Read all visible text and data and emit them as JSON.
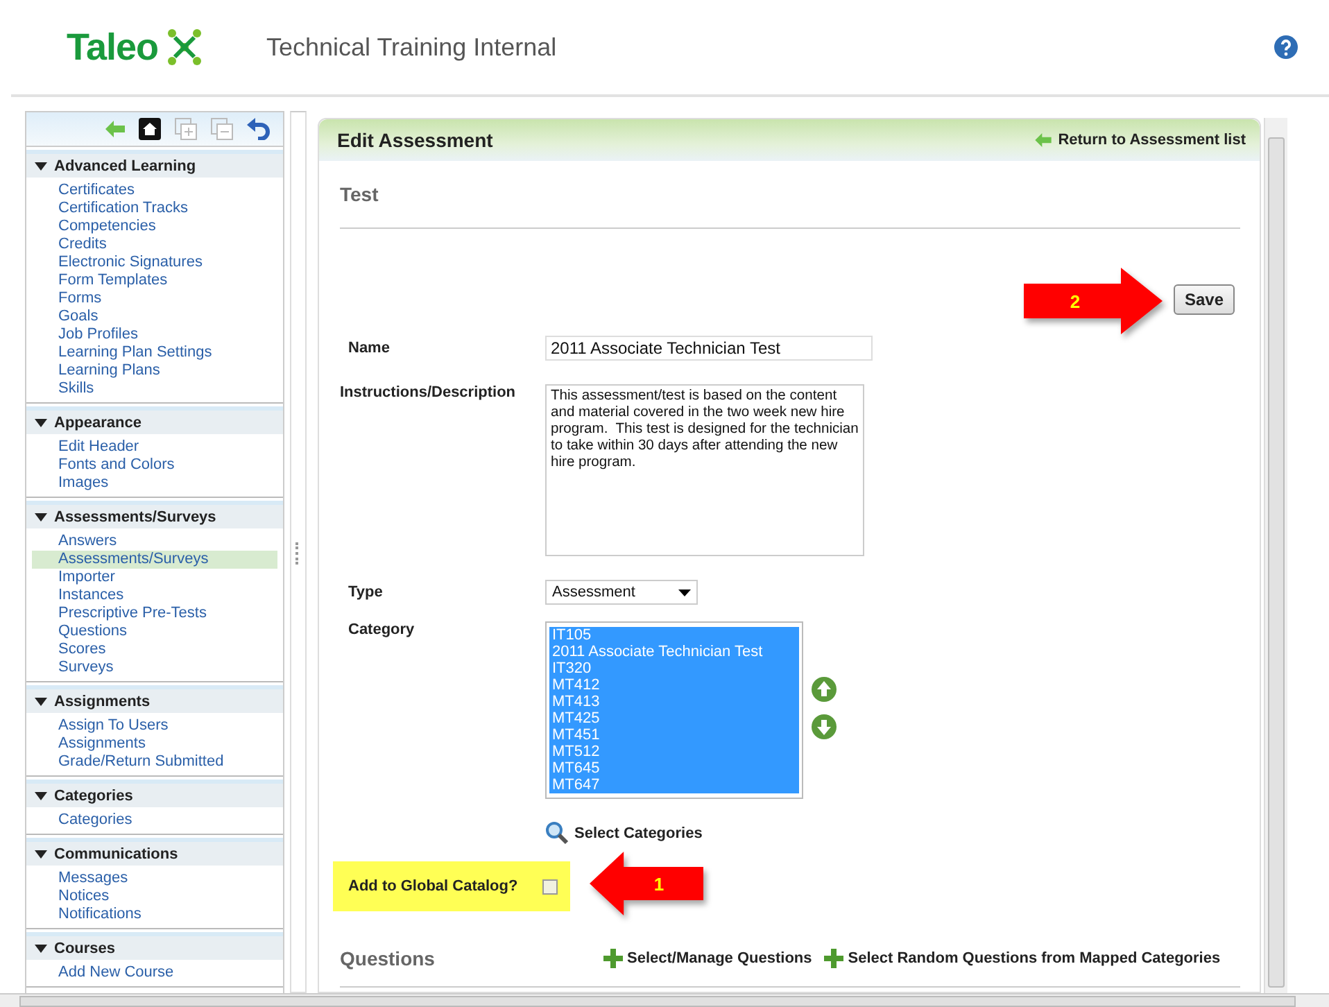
{
  "header": {
    "logo": "Taleo",
    "title": "Technical Training Internal"
  },
  "sidebar": {
    "sections": [
      {
        "title": "Advanced Learning",
        "expanded": true,
        "items": [
          {
            "label": "Certificates",
            "selected": false
          },
          {
            "label": "Certification Tracks",
            "selected": false
          },
          {
            "label": "Competencies",
            "selected": false
          },
          {
            "label": "Credits",
            "selected": false
          },
          {
            "label": "Electronic Signatures",
            "selected": false
          },
          {
            "label": "Form Templates",
            "selected": false
          },
          {
            "label": "Forms",
            "selected": false
          },
          {
            "label": "Goals",
            "selected": false
          },
          {
            "label": "Job Profiles",
            "selected": false
          },
          {
            "label": "Learning Plan Settings",
            "selected": false
          },
          {
            "label": "Learning Plans",
            "selected": false
          },
          {
            "label": "Skills",
            "selected": false
          }
        ]
      },
      {
        "title": "Appearance",
        "expanded": true,
        "items": [
          {
            "label": "Edit Header",
            "selected": false
          },
          {
            "label": "Fonts and Colors",
            "selected": false
          },
          {
            "label": "Images",
            "selected": false
          }
        ]
      },
      {
        "title": "Assessments/Surveys",
        "expanded": true,
        "items": [
          {
            "label": "Answers",
            "selected": false
          },
          {
            "label": "Assessments/Surveys",
            "selected": true
          },
          {
            "label": "Importer",
            "selected": false
          },
          {
            "label": "Instances",
            "selected": false
          },
          {
            "label": "Prescriptive Pre-Tests",
            "selected": false
          },
          {
            "label": "Questions",
            "selected": false
          },
          {
            "label": "Scores",
            "selected": false
          },
          {
            "label": "Surveys",
            "selected": false
          }
        ]
      },
      {
        "title": "Assignments",
        "expanded": true,
        "items": [
          {
            "label": "Assign To Users",
            "selected": false
          },
          {
            "label": "Assignments",
            "selected": false
          },
          {
            "label": "Grade/Return Submitted",
            "selected": false
          }
        ]
      },
      {
        "title": "Categories",
        "expanded": true,
        "items": [
          {
            "label": "Categories",
            "selected": false
          }
        ]
      },
      {
        "title": "Communications",
        "expanded": true,
        "items": [
          {
            "label": "Messages",
            "selected": false
          },
          {
            "label": "Notices",
            "selected": false
          },
          {
            "label": "Notifications",
            "selected": false
          }
        ]
      },
      {
        "title": "Courses",
        "expanded": true,
        "items": [
          {
            "label": "Add New Course",
            "selected": false
          }
        ]
      }
    ]
  },
  "panel": {
    "title": "Edit Assessment",
    "return_link": "Return to Assessment list",
    "section": "Test",
    "save": "Save",
    "name_label": "Name",
    "name_value": "2011 Associate Technician Test",
    "description_label": "Instructions/Description",
    "description_value": "This assessment/test is based on the content and material covered in the two week new hire program.  This test is designed for the technician to take within 30 days after attending the new hire program.",
    "type_label": "Type",
    "type_value": "Assessment",
    "category_label": "Category",
    "categories": [
      {
        "label": "IT105",
        "selected": true
      },
      {
        "label": "2011 Associate Technician Test",
        "selected": true
      },
      {
        "label": "IT320",
        "selected": true
      },
      {
        "label": "MT412",
        "selected": true
      },
      {
        "label": "MT413",
        "selected": true
      },
      {
        "label": "MT425",
        "selected": true
      },
      {
        "label": "MT451",
        "selected": true
      },
      {
        "label": "MT512",
        "selected": true
      },
      {
        "label": "MT645",
        "selected": true
      },
      {
        "label": "MT647",
        "selected": true
      }
    ],
    "select_categories": "Select Categories",
    "global_catalog": {
      "label": "Add to Global Catalog?",
      "checked": false
    },
    "questions_title": "Questions",
    "questions_actions": [
      "Select/Manage Questions",
      "Select Random Questions from Mapped Categories"
    ]
  },
  "callouts": [
    {
      "number": "2"
    },
    {
      "number": "1"
    }
  ]
}
